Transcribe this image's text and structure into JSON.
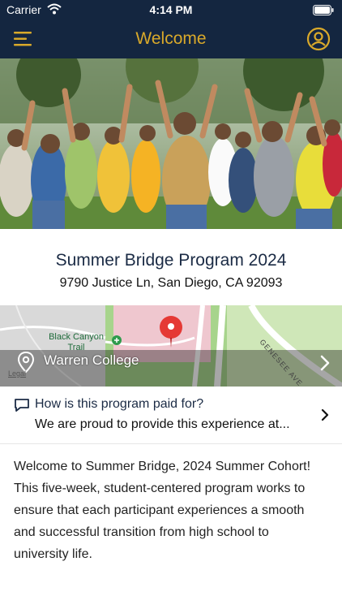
{
  "status_bar": {
    "carrier": "Carrier",
    "time": "4:14 PM"
  },
  "nav": {
    "title": "Welcome"
  },
  "program": {
    "name": "Summer Bridge Program 2024",
    "address": "9790 Justice Ln, San Diego, CA 92093"
  },
  "map": {
    "location_label": "Warren College",
    "trail_label": "Black Canyon Trail",
    "street_label": "GENESEE AVE",
    "legal": "Legal"
  },
  "payment": {
    "question": "How is this program paid for?",
    "answer": "We are proud to provide this experience at..."
  },
  "description": "Welcome to Summer Bridge, 2024 Summer Cohort! This five-week, student-centered program works to ensure that each participant experiences a smooth and successful transition from high school to university life.",
  "colors": {
    "nav_background": "#142640",
    "accent_gold": "#d9a92a",
    "map_pin": "#e53935"
  },
  "icons": [
    "wifi-icon",
    "battery-icon",
    "menu-icon",
    "account-icon",
    "location-pin-icon",
    "map-pin-icon",
    "chevron-right-icon",
    "chat-bubble-icon"
  ]
}
